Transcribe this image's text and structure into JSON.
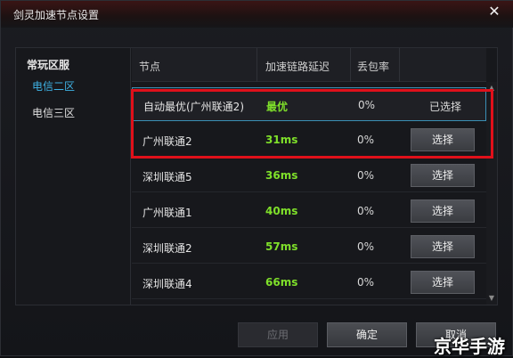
{
  "window": {
    "title": "剑灵加速节点设置",
    "close_glyph": "✕"
  },
  "sidebar": {
    "heading": "常玩区服",
    "items": [
      {
        "label": "电信二区",
        "active": true
      },
      {
        "label": "电信三区",
        "active": false
      }
    ]
  },
  "table": {
    "headers": [
      "节点",
      "加速链路延迟",
      "丢包率"
    ],
    "rows": [
      {
        "node": "自动最优(广州联通2)",
        "latency": "最优",
        "loss": "0%",
        "status": "已选择",
        "button": ""
      },
      {
        "node": "广州联通2",
        "latency": "31ms",
        "loss": "0%",
        "status": "",
        "button": "选择"
      },
      {
        "node": "深圳联通5",
        "latency": "36ms",
        "loss": "0%",
        "status": "",
        "button": "选择"
      },
      {
        "node": "广州联通1",
        "latency": "40ms",
        "loss": "0%",
        "status": "",
        "button": "选择"
      },
      {
        "node": "深圳联通2",
        "latency": "57ms",
        "loss": "0%",
        "status": "",
        "button": "选择"
      },
      {
        "node": "深圳联通4",
        "latency": "66ms",
        "loss": "0%",
        "status": "",
        "button": "选择"
      }
    ]
  },
  "footer": {
    "apply": "应用",
    "ok": "确定",
    "cancel": "取消"
  },
  "watermark": "京华手游",
  "colors": {
    "accent": "#3fb3e6",
    "latency": "#7fe02a",
    "highlight": "#e0101a",
    "title_bar": "#3a1414"
  }
}
